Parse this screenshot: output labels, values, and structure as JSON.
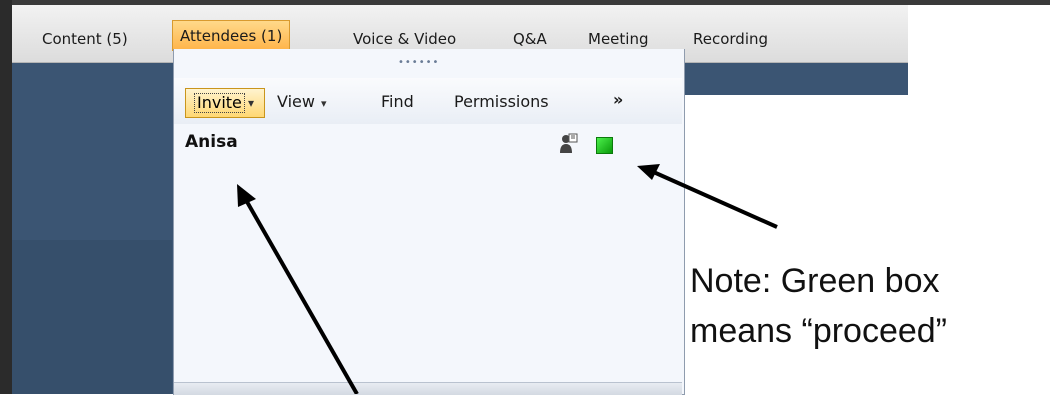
{
  "menu": {
    "content": "Content (5)",
    "attendees": "Attendees (1)",
    "voice_video": "Voice & Video",
    "qa": "Q&A",
    "meeting": "Meeting",
    "recording": "Recording"
  },
  "toolbar": {
    "invite": "Invite",
    "view": "View",
    "find": "Find",
    "permissions": "Permissions",
    "overflow": "»"
  },
  "attendee": {
    "name": "Anisa",
    "status_color": "#22c322"
  },
  "note": {
    "line1": "Note: Green box",
    "line2": "means “proceed”"
  },
  "colors": {
    "active_tab": "#ffc35a",
    "app_background": "#3b5573"
  }
}
